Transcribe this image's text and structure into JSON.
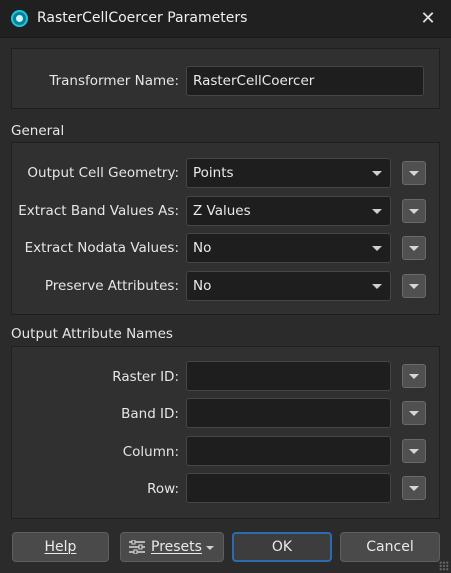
{
  "window": {
    "title": "RasterCellCoercer Parameters",
    "close_icon": "close-icon"
  },
  "transformer": {
    "label": "Transformer Name:",
    "value": "RasterCellCoercer"
  },
  "general": {
    "title": "General",
    "fields": [
      {
        "label": "Output Cell Geometry:",
        "value": "Points"
      },
      {
        "label": "Extract Band Values As:",
        "value": "Z Values"
      },
      {
        "label": "Extract Nodata Values:",
        "value": "No"
      },
      {
        "label": "Preserve Attributes:",
        "value": "No"
      }
    ]
  },
  "output_attrs": {
    "title": "Output Attribute Names",
    "fields": [
      {
        "label": "Raster ID:",
        "value": ""
      },
      {
        "label": "Band ID:",
        "value": ""
      },
      {
        "label": "Column:",
        "value": ""
      },
      {
        "label": "Row:",
        "value": ""
      }
    ]
  },
  "buttons": {
    "help": "Help",
    "presets": "Presets",
    "ok": "OK",
    "cancel": "Cancel"
  },
  "colors": {
    "background": "#2b2b2b",
    "ok_border": "#2c6bb0",
    "accent": "#18c7e0"
  }
}
